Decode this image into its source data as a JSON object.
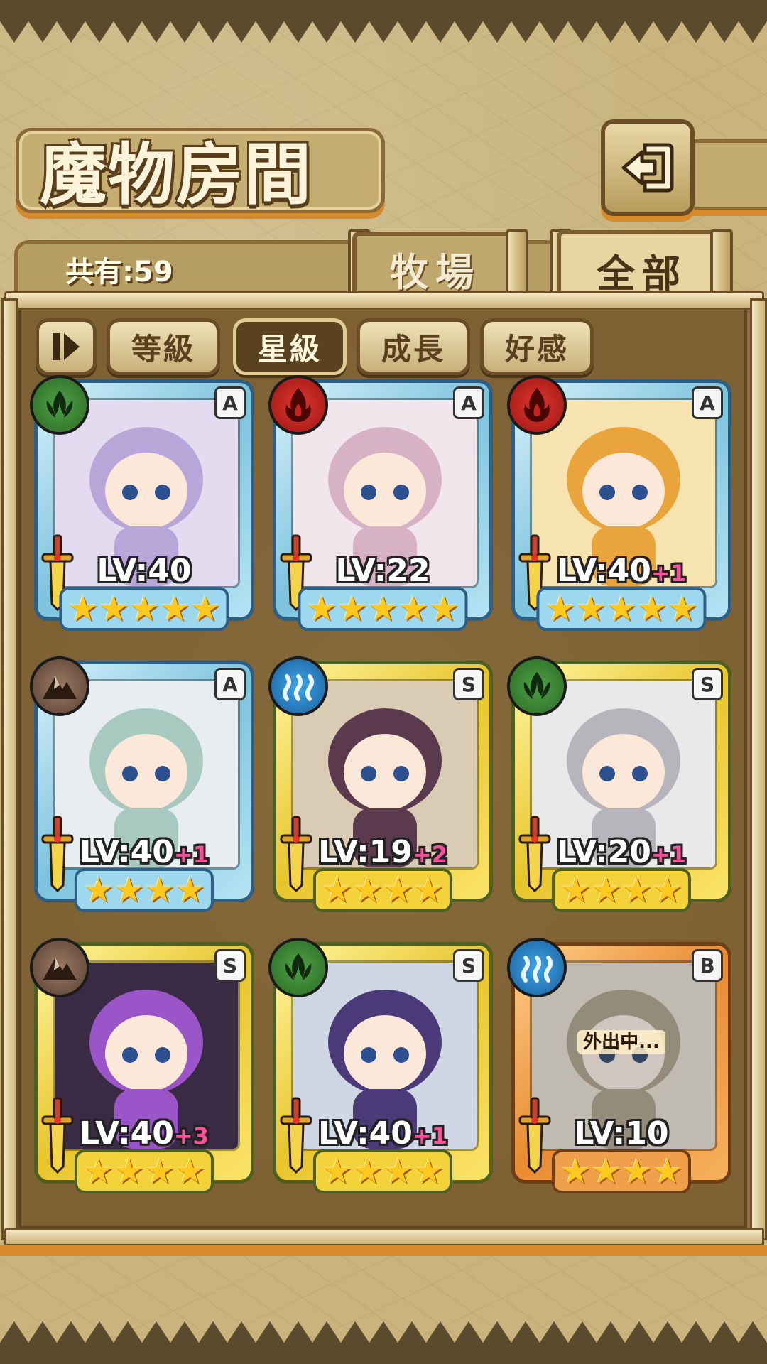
{
  "title": "魔物房間",
  "owned_count": "共有:59",
  "tabs": [
    {
      "label": "牧場",
      "active": false
    },
    {
      "label": "全部",
      "active": true
    }
  ],
  "sort_buttons": [
    {
      "label": "等級",
      "active": false
    },
    {
      "label": "星級",
      "active": true
    },
    {
      "label": "成長",
      "active": false
    },
    {
      "label": "好感",
      "active": false
    }
  ],
  "icons": {
    "back": "return-arrow-icon",
    "toggle": "sort-order-icon"
  },
  "colors": {
    "rank_A": "#7cc3de",
    "rank_S": "#e7c52a",
    "rank_B": "#e88a32",
    "grass": "#3d8a35",
    "fire": "#c8231d",
    "water": "#2d86c9",
    "earth": "#7a5a48",
    "bonus_text": "#ff4f9a"
  },
  "monsters": [
    {
      "rank": "A",
      "element": "grass",
      "level": "LV:40",
      "bonus": "",
      "stars": 5,
      "away": ""
    },
    {
      "rank": "A",
      "element": "fire",
      "level": "LV:22",
      "bonus": "",
      "stars": 5,
      "away": ""
    },
    {
      "rank": "A",
      "element": "fire",
      "level": "LV:40",
      "bonus": "+1",
      "stars": 5,
      "away": ""
    },
    {
      "rank": "A",
      "element": "earth",
      "level": "LV:40",
      "bonus": "+1",
      "stars": 4,
      "away": ""
    },
    {
      "rank": "S",
      "element": "water",
      "level": "LV:19",
      "bonus": "+2",
      "stars": 4,
      "away": ""
    },
    {
      "rank": "S",
      "element": "grass",
      "level": "LV:20",
      "bonus": "+1",
      "stars": 4,
      "away": ""
    },
    {
      "rank": "S",
      "element": "earth",
      "level": "LV:40",
      "bonus": "+3",
      "stars": 4,
      "away": ""
    },
    {
      "rank": "S",
      "element": "grass",
      "level": "LV:40",
      "bonus": "+1",
      "stars": 4,
      "away": ""
    },
    {
      "rank": "B",
      "element": "water",
      "level": "LV:10",
      "bonus": "",
      "stars": 4,
      "away": "外出中..."
    }
  ]
}
